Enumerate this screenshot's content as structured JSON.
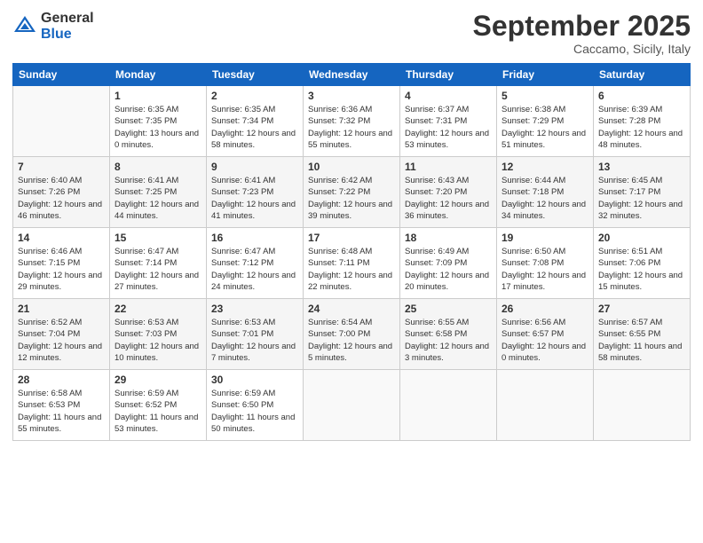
{
  "logo": {
    "general": "General",
    "blue": "Blue"
  },
  "title": "September 2025",
  "subtitle": "Caccamo, Sicily, Italy",
  "days_of_week": [
    "Sunday",
    "Monday",
    "Tuesday",
    "Wednesday",
    "Thursday",
    "Friday",
    "Saturday"
  ],
  "weeks": [
    [
      {
        "day": "",
        "sunrise": "",
        "sunset": "",
        "daylight": ""
      },
      {
        "day": "1",
        "sunrise": "Sunrise: 6:35 AM",
        "sunset": "Sunset: 7:35 PM",
        "daylight": "Daylight: 13 hours and 0 minutes."
      },
      {
        "day": "2",
        "sunrise": "Sunrise: 6:35 AM",
        "sunset": "Sunset: 7:34 PM",
        "daylight": "Daylight: 12 hours and 58 minutes."
      },
      {
        "day": "3",
        "sunrise": "Sunrise: 6:36 AM",
        "sunset": "Sunset: 7:32 PM",
        "daylight": "Daylight: 12 hours and 55 minutes."
      },
      {
        "day": "4",
        "sunrise": "Sunrise: 6:37 AM",
        "sunset": "Sunset: 7:31 PM",
        "daylight": "Daylight: 12 hours and 53 minutes."
      },
      {
        "day": "5",
        "sunrise": "Sunrise: 6:38 AM",
        "sunset": "Sunset: 7:29 PM",
        "daylight": "Daylight: 12 hours and 51 minutes."
      },
      {
        "day": "6",
        "sunrise": "Sunrise: 6:39 AM",
        "sunset": "Sunset: 7:28 PM",
        "daylight": "Daylight: 12 hours and 48 minutes."
      }
    ],
    [
      {
        "day": "7",
        "sunrise": "Sunrise: 6:40 AM",
        "sunset": "Sunset: 7:26 PM",
        "daylight": "Daylight: 12 hours and 46 minutes."
      },
      {
        "day": "8",
        "sunrise": "Sunrise: 6:41 AM",
        "sunset": "Sunset: 7:25 PM",
        "daylight": "Daylight: 12 hours and 44 minutes."
      },
      {
        "day": "9",
        "sunrise": "Sunrise: 6:41 AM",
        "sunset": "Sunset: 7:23 PM",
        "daylight": "Daylight: 12 hours and 41 minutes."
      },
      {
        "day": "10",
        "sunrise": "Sunrise: 6:42 AM",
        "sunset": "Sunset: 7:22 PM",
        "daylight": "Daylight: 12 hours and 39 minutes."
      },
      {
        "day": "11",
        "sunrise": "Sunrise: 6:43 AM",
        "sunset": "Sunset: 7:20 PM",
        "daylight": "Daylight: 12 hours and 36 minutes."
      },
      {
        "day": "12",
        "sunrise": "Sunrise: 6:44 AM",
        "sunset": "Sunset: 7:18 PM",
        "daylight": "Daylight: 12 hours and 34 minutes."
      },
      {
        "day": "13",
        "sunrise": "Sunrise: 6:45 AM",
        "sunset": "Sunset: 7:17 PM",
        "daylight": "Daylight: 12 hours and 32 minutes."
      }
    ],
    [
      {
        "day": "14",
        "sunrise": "Sunrise: 6:46 AM",
        "sunset": "Sunset: 7:15 PM",
        "daylight": "Daylight: 12 hours and 29 minutes."
      },
      {
        "day": "15",
        "sunrise": "Sunrise: 6:47 AM",
        "sunset": "Sunset: 7:14 PM",
        "daylight": "Daylight: 12 hours and 27 minutes."
      },
      {
        "day": "16",
        "sunrise": "Sunrise: 6:47 AM",
        "sunset": "Sunset: 7:12 PM",
        "daylight": "Daylight: 12 hours and 24 minutes."
      },
      {
        "day": "17",
        "sunrise": "Sunrise: 6:48 AM",
        "sunset": "Sunset: 7:11 PM",
        "daylight": "Daylight: 12 hours and 22 minutes."
      },
      {
        "day": "18",
        "sunrise": "Sunrise: 6:49 AM",
        "sunset": "Sunset: 7:09 PM",
        "daylight": "Daylight: 12 hours and 20 minutes."
      },
      {
        "day": "19",
        "sunrise": "Sunrise: 6:50 AM",
        "sunset": "Sunset: 7:08 PM",
        "daylight": "Daylight: 12 hours and 17 minutes."
      },
      {
        "day": "20",
        "sunrise": "Sunrise: 6:51 AM",
        "sunset": "Sunset: 7:06 PM",
        "daylight": "Daylight: 12 hours and 15 minutes."
      }
    ],
    [
      {
        "day": "21",
        "sunrise": "Sunrise: 6:52 AM",
        "sunset": "Sunset: 7:04 PM",
        "daylight": "Daylight: 12 hours and 12 minutes."
      },
      {
        "day": "22",
        "sunrise": "Sunrise: 6:53 AM",
        "sunset": "Sunset: 7:03 PM",
        "daylight": "Daylight: 12 hours and 10 minutes."
      },
      {
        "day": "23",
        "sunrise": "Sunrise: 6:53 AM",
        "sunset": "Sunset: 7:01 PM",
        "daylight": "Daylight: 12 hours and 7 minutes."
      },
      {
        "day": "24",
        "sunrise": "Sunrise: 6:54 AM",
        "sunset": "Sunset: 7:00 PM",
        "daylight": "Daylight: 12 hours and 5 minutes."
      },
      {
        "day": "25",
        "sunrise": "Sunrise: 6:55 AM",
        "sunset": "Sunset: 6:58 PM",
        "daylight": "Daylight: 12 hours and 3 minutes."
      },
      {
        "day": "26",
        "sunrise": "Sunrise: 6:56 AM",
        "sunset": "Sunset: 6:57 PM",
        "daylight": "Daylight: 12 hours and 0 minutes."
      },
      {
        "day": "27",
        "sunrise": "Sunrise: 6:57 AM",
        "sunset": "Sunset: 6:55 PM",
        "daylight": "Daylight: 11 hours and 58 minutes."
      }
    ],
    [
      {
        "day": "28",
        "sunrise": "Sunrise: 6:58 AM",
        "sunset": "Sunset: 6:53 PM",
        "daylight": "Daylight: 11 hours and 55 minutes."
      },
      {
        "day": "29",
        "sunrise": "Sunrise: 6:59 AM",
        "sunset": "Sunset: 6:52 PM",
        "daylight": "Daylight: 11 hours and 53 minutes."
      },
      {
        "day": "30",
        "sunrise": "Sunrise: 6:59 AM",
        "sunset": "Sunset: 6:50 PM",
        "daylight": "Daylight: 11 hours and 50 minutes."
      },
      {
        "day": "",
        "sunrise": "",
        "sunset": "",
        "daylight": ""
      },
      {
        "day": "",
        "sunrise": "",
        "sunset": "",
        "daylight": ""
      },
      {
        "day": "",
        "sunrise": "",
        "sunset": "",
        "daylight": ""
      },
      {
        "day": "",
        "sunrise": "",
        "sunset": "",
        "daylight": ""
      }
    ]
  ]
}
